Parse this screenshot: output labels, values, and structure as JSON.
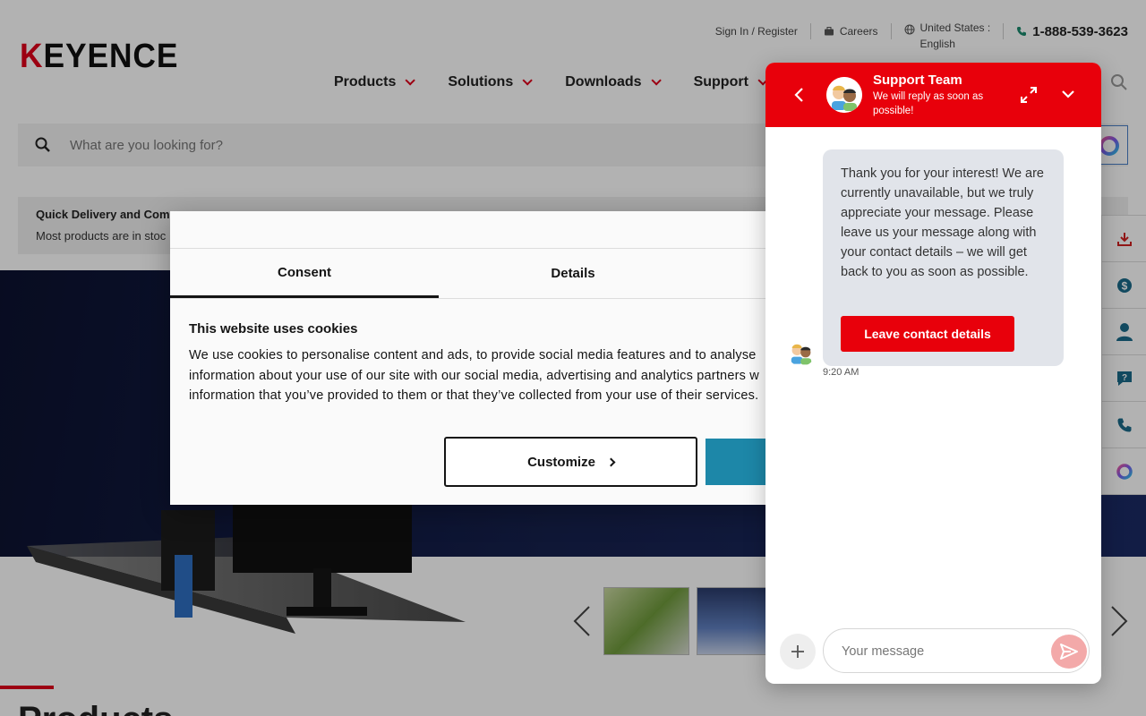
{
  "header": {
    "logo_text": "KEYENCE",
    "utility": {
      "signin": "Sign In / Register",
      "careers": "Careers",
      "lang_line1": "United States :",
      "lang_line2": "English",
      "phone": "1-888-539-3623"
    },
    "nav": [
      {
        "label": "Products"
      },
      {
        "label": "Solutions"
      },
      {
        "label": "Downloads"
      },
      {
        "label": "Support"
      }
    ]
  },
  "search": {
    "placeholder": "What are you looking for?"
  },
  "banner": {
    "title": "Quick Delivery and Comp",
    "text": "Most products are in stoc"
  },
  "section": {
    "title": "Products"
  },
  "cookie_dialog": {
    "tabs": [
      {
        "label": "Consent",
        "active": true
      },
      {
        "label": "Details",
        "active": false
      }
    ],
    "heading": "This website uses cookies",
    "body": "We use cookies to personalise content and ads, to provide social media features and to analyse information about your use of our site with our social media, advertising and analytics partners w information that you’ve provided to them or that they’ve collected from your use of their services.",
    "customize_label": "Customize"
  },
  "chat": {
    "agent_name": "Support Team",
    "status": "We will reply as soon as possible!",
    "message": "Thank you for your interest! We are currently unavailable, but we truly appreciate your message. Please leave us your message along with your contact details – we will get back to you as soon as possible.",
    "cta_label": "Leave contact details",
    "timestamp": "9:20 AM",
    "input_placeholder": "Your message"
  },
  "colors": {
    "brand_red": "#e8000b",
    "cookie_accent": "#1d87a8",
    "hero_navy": "#16214e"
  },
  "sidetools": [
    "download-icon",
    "price-icon",
    "person-icon",
    "question-icon",
    "phone-icon",
    "ai-icon"
  ]
}
